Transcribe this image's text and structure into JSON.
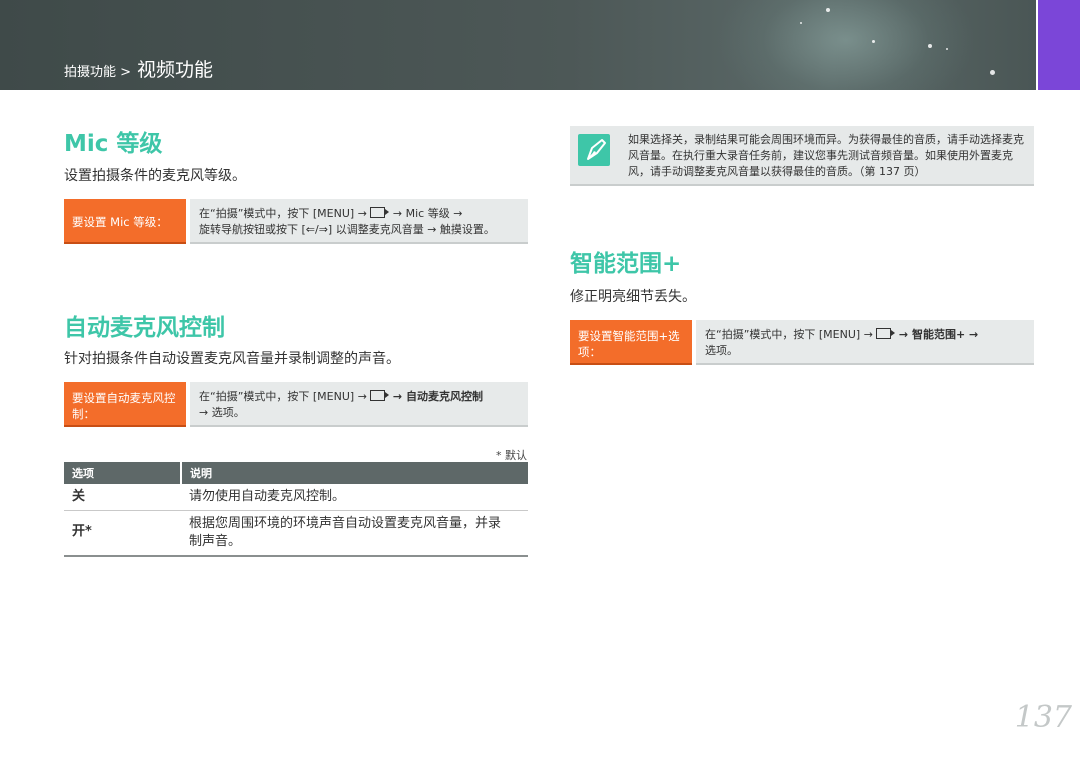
{
  "header": {
    "breadcrumb_small": "拍摄功能 >",
    "breadcrumb_big": "视频功能"
  },
  "left": {
    "mic": {
      "title": "Mic 等级",
      "lead": "设置拍摄条件的麦克风等级。",
      "tag": "要设置 Mic 等级：",
      "step_line1_a": "在“拍摄”模式中，按下 [MENU] →",
      "step_line1_b": "→ Mic 等级 →",
      "step_line2": "旋转导航按钮或按下 [⇐/⇒] 以调整麦克风音量 → 触摸设置。"
    },
    "auto": {
      "title": "自动麦克风控制",
      "lead": "针对拍摄条件自动设置麦克风音量并录制调整的声音。",
      "tag": "要设置自动麦克风控制：",
      "step_line1_a": "在“拍摄”模式中，按下 [MENU] →",
      "step_line1_b": "→ 自动麦克风控制",
      "step_line2": "→ 选项。"
    },
    "default_note": "* 默认",
    "table": {
      "headers": [
        "选项",
        "说明"
      ],
      "rows": [
        {
          "option": "关",
          "desc": "请勿使用自动麦克风控制。"
        },
        {
          "option": "开*",
          "desc": "根据您周围环境的环境声音自动设置麦克风音量，并录制声音。"
        }
      ]
    }
  },
  "right": {
    "note": {
      "icon": "pen-nib-icon",
      "text": "如果选择关，录制结果可能会周围环境而异。为获得最佳的音质，请手动选择麦克风音量。在执行重大录音任务前，建议您事先测试音频音量。如果使用外置麦克风，请手动调整麦克风音量以获得最佳的音质。（第 137 页）"
    },
    "smart": {
      "title": "智能范围+",
      "lead": "修正明亮细节丢失。",
      "tag": "要设置智能范围+选项：",
      "step_line1_a": "在“拍摄”模式中，按下 [MENU] →",
      "step_line1_b": "→ 智能范围+ →",
      "step_line2": "选项。"
    }
  },
  "page_number": "137",
  "colors": {
    "accent": "#3ec6a8",
    "tag_orange": "#f36d2a",
    "side_tab": "#7b46d8"
  }
}
